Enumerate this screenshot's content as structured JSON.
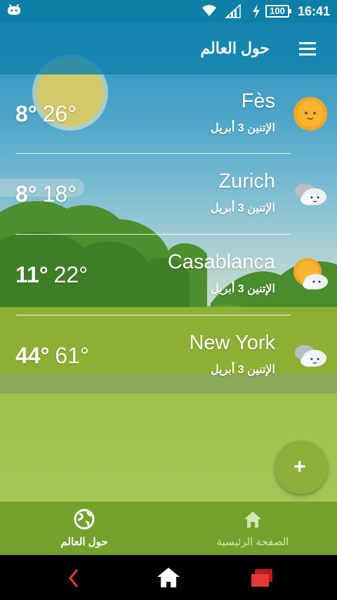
{
  "status_bar": {
    "battery": "100",
    "time": "16:41"
  },
  "toolbar": {
    "title": "حول العالم",
    "menu_icon": "hamburger-menu-icon"
  },
  "cities": [
    {
      "name": "Fès",
      "date": "الإتنين 3 أبريل",
      "low": "8°",
      "high": "26°",
      "icon": "sunny-icon"
    },
    {
      "name": "Zurich",
      "date": "الإتنين 3 أبريل",
      "low": "8°",
      "high": "18°",
      "icon": "cloudy-icon"
    },
    {
      "name": "Casablanca",
      "date": "الإتنين 3 أبريل",
      "low": "11°",
      "high": "22°",
      "icon": "partly-cloudy-icon"
    },
    {
      "name": "New York",
      "date": "الإتنين 3 أبريل",
      "low": "44°",
      "high": "61°",
      "icon": "cloudy-icon"
    }
  ],
  "fab": {
    "label": "+",
    "icon": "add-icon"
  },
  "tabs": [
    {
      "label": "حول العالم",
      "icon": "globe-icon",
      "active": true
    },
    {
      "label": "الصفحة الرئيسية",
      "icon": "home-icon",
      "active": false
    }
  ],
  "colors": {
    "toolbar": "#1082ac",
    "status_bar": "#0e7fa6",
    "tab_bar": "#72a22c",
    "fab": "#8caf3c"
  }
}
